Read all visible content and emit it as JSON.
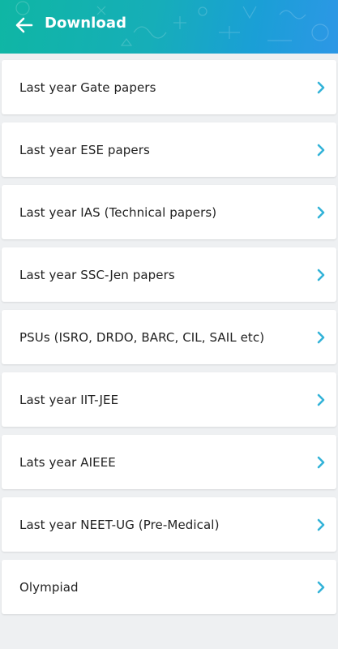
{
  "header": {
    "title": "Download",
    "back_icon": "arrow-left-icon",
    "gradient_start": "#0fb6a4",
    "gradient_end": "#2d97e6"
  },
  "list": {
    "chevron_icon": "chevron-right-icon",
    "chevron_color": "#33b3d8",
    "items": [
      {
        "label": "Last year Gate papers"
      },
      {
        "label": "Last year ESE papers"
      },
      {
        "label": "Last year IAS (Technical papers)"
      },
      {
        "label": "Last year SSC-Jen papers"
      },
      {
        "label": "PSUs (ISRO, DRDO, BARC, CIL, SAIL etc)"
      },
      {
        "label": "Last year IIT-JEE"
      },
      {
        "label": "Lats year AIEEE"
      },
      {
        "label": "Last year NEET-UG (Pre-Medical)"
      },
      {
        "label": "Olympiad"
      }
    ]
  }
}
